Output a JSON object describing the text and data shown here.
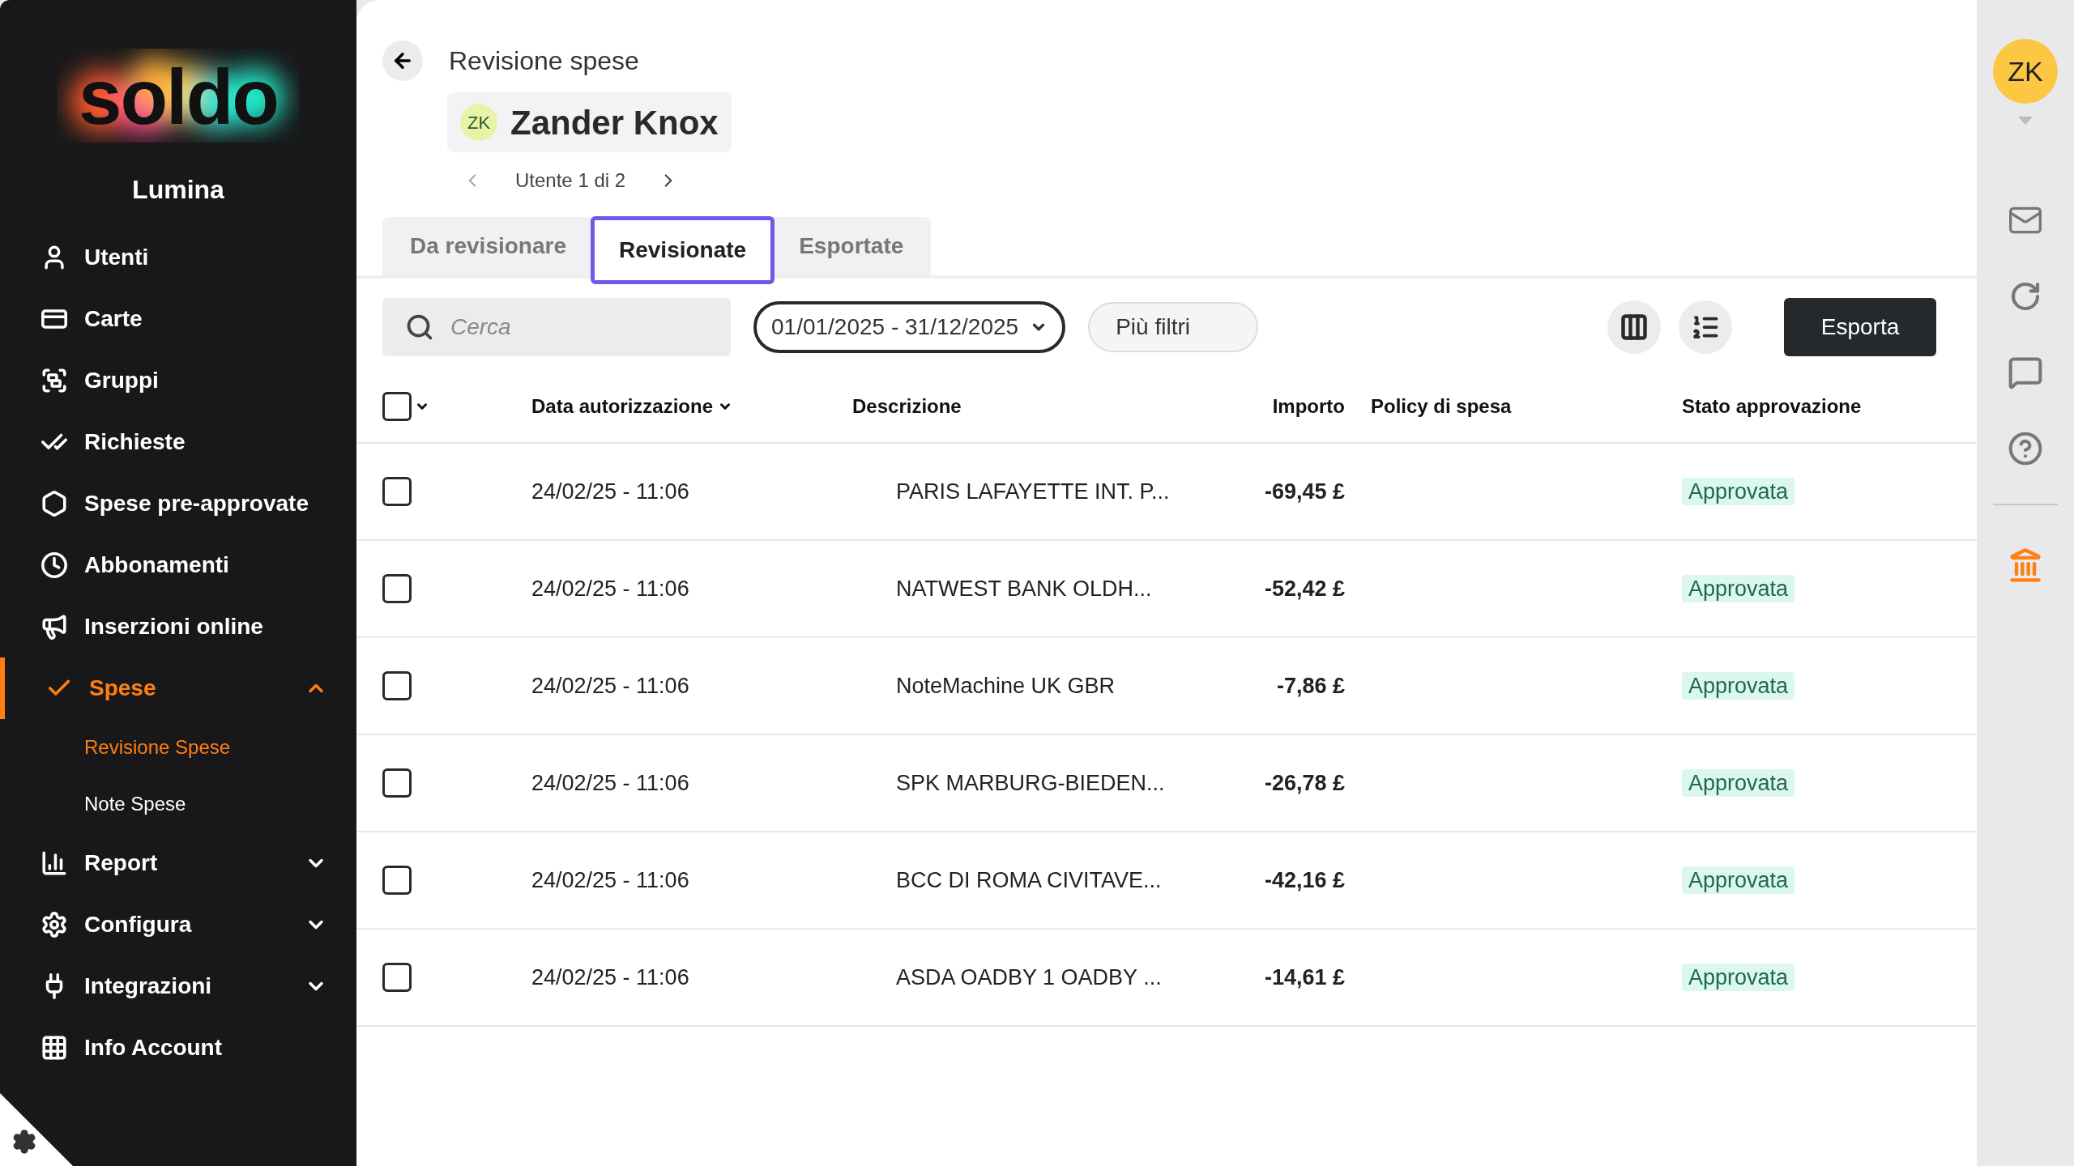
{
  "brand": {
    "logo": "soldo",
    "company": "Lumina"
  },
  "sidebar": {
    "items": [
      {
        "label": "Utenti",
        "selected": false
      },
      {
        "label": "Carte",
        "selected": false
      },
      {
        "label": "Gruppi",
        "selected": false
      },
      {
        "label": "Richieste",
        "selected": false
      },
      {
        "label": "Spese pre-approvate",
        "selected": false
      },
      {
        "label": "Abbonamenti",
        "selected": false
      },
      {
        "label": "Inserzioni online",
        "selected": false
      },
      {
        "label": "Spese",
        "selected": true,
        "expanded": true,
        "children": [
          {
            "label": "Revisione Spese",
            "selected": true
          },
          {
            "label": "Note Spese",
            "selected": false
          }
        ]
      },
      {
        "label": "Report",
        "selected": false,
        "expanded": false
      },
      {
        "label": "Configura",
        "selected": false,
        "expanded": false
      },
      {
        "label": "Integrazioni",
        "selected": false,
        "expanded": false
      },
      {
        "label": "Info Account",
        "selected": false
      }
    ]
  },
  "header": {
    "breadcrumb": "Revisione spese",
    "user_initials": "ZK",
    "user_name": "Zander Knox",
    "pager": "Utente 1 di 2"
  },
  "tabs": [
    {
      "label": "Da revisionare",
      "selected": false
    },
    {
      "label": "Revisionate",
      "selected": true
    },
    {
      "label": "Esportate",
      "selected": false
    }
  ],
  "toolbar": {
    "search": {
      "placeholder": "Cerca"
    },
    "date_range": "01/01/2025 - 31/12/2025",
    "filters": "Più filtri",
    "export": "Esporta"
  },
  "table": {
    "select_all": {
      "checked": false
    },
    "columns": [
      "Data autorizzazione",
      "Descrizione",
      "Importo",
      "Policy di spesa",
      "Stato approvazione"
    ],
    "rows": [
      {
        "checked": false,
        "date": "24/02/25 - 11:06",
        "description": "PARIS LAFAYETTE INT. P...",
        "amount": "-69,45 £",
        "status": "Approvata"
      },
      {
        "checked": false,
        "date": "24/02/25 - 11:06",
        "description": "NATWEST BANK OLDH...",
        "amount": "-52,42 £",
        "status": "Approvata"
      },
      {
        "checked": false,
        "date": "24/02/25 - 11:06",
        "description": "NoteMachine UK GBR",
        "amount": "-7,86 £",
        "status": "Approvata"
      },
      {
        "checked": false,
        "date": "24/02/25 - 11:06",
        "description": "SPK MARBURG-BIEDEN...",
        "amount": "-26,78 £",
        "status": "Approvata"
      },
      {
        "checked": false,
        "date": "24/02/25 - 11:06",
        "description": "BCC DI ROMA CIVITAVE...",
        "amount": "-42,16 £",
        "status": "Approvata"
      },
      {
        "checked": false,
        "date": "24/02/25 - 11:06",
        "description": "ASDA OADBY 1 OADBY ...",
        "amount": "-14,61 £",
        "status": "Approvata"
      }
    ]
  },
  "account": {
    "initials": "ZK"
  }
}
